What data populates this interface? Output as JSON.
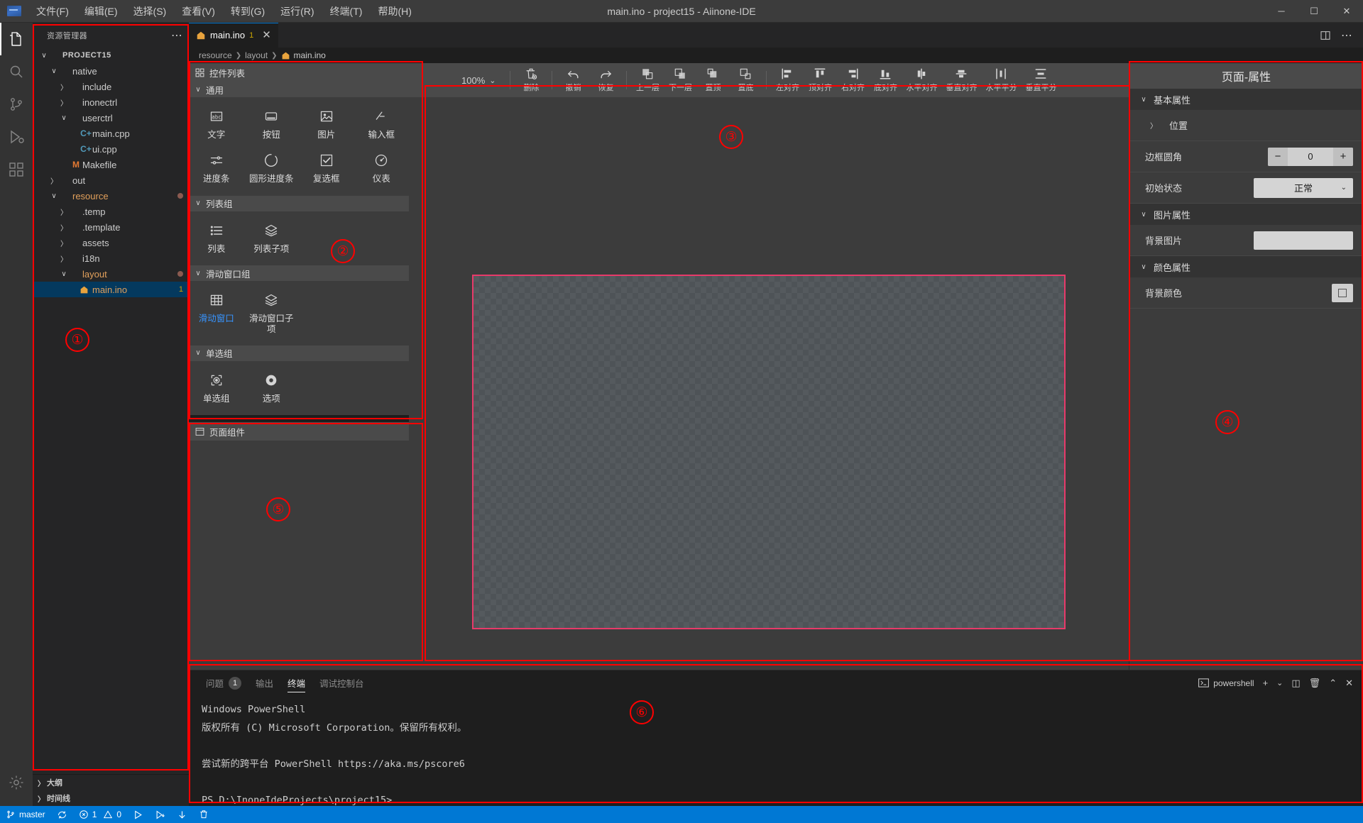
{
  "titlebar": {
    "title": "main.ino - project15 - Aiinone-IDE",
    "logo_icon": "app-logo-icon",
    "menus": [
      {
        "label": "文件(F)"
      },
      {
        "label": "编辑(E)"
      },
      {
        "label": "选择(S)"
      },
      {
        "label": "查看(V)"
      },
      {
        "label": "转到(G)"
      },
      {
        "label": "运行(R)"
      },
      {
        "label": "终端(T)"
      },
      {
        "label": "帮助(H)"
      }
    ],
    "window_controls": {
      "minimize": "─",
      "maximize": "☐",
      "close": "✕"
    }
  },
  "activitybar": {
    "items": [
      {
        "name": "explorer",
        "icon": "files-icon",
        "active": true
      },
      {
        "name": "search",
        "icon": "search-icon",
        "active": false
      },
      {
        "name": "source-control",
        "icon": "source-control-icon",
        "active": false
      },
      {
        "name": "run-debug",
        "icon": "run-debug-icon",
        "active": false
      },
      {
        "name": "extensions",
        "icon": "extensions-icon",
        "active": false
      }
    ],
    "bottom": [
      {
        "name": "settings",
        "icon": "gear-icon"
      }
    ]
  },
  "sidebar": {
    "header_title": "资源管理器",
    "more_actions": "⋯",
    "tree": [
      {
        "label": "PROJECT15",
        "depth": 0,
        "twisty": "open",
        "kind": "root"
      },
      {
        "label": "native",
        "depth": 1,
        "twisty": "open",
        "kind": "folder"
      },
      {
        "label": "include",
        "depth": 2,
        "twisty": "closed",
        "kind": "folder"
      },
      {
        "label": "inonectrl",
        "depth": 2,
        "twisty": "closed",
        "kind": "folder"
      },
      {
        "label": "userctrl",
        "depth": 2,
        "twisty": "open",
        "kind": "folder"
      },
      {
        "label": "main.cpp",
        "depth": 3,
        "twisty": "none",
        "kind": "cpp"
      },
      {
        "label": "ui.cpp",
        "depth": 3,
        "twisty": "none",
        "kind": "cpp"
      },
      {
        "label": "Makefile",
        "depth": 2,
        "twisty": "none",
        "kind": "make"
      },
      {
        "label": "out",
        "depth": 1,
        "twisty": "closed",
        "kind": "folder"
      },
      {
        "label": "resource",
        "depth": 1,
        "twisty": "open",
        "kind": "folder-mod",
        "badge_dot": true
      },
      {
        "label": ".temp",
        "depth": 2,
        "twisty": "closed",
        "kind": "folder"
      },
      {
        "label": ".template",
        "depth": 2,
        "twisty": "closed",
        "kind": "folder"
      },
      {
        "label": "assets",
        "depth": 2,
        "twisty": "closed",
        "kind": "folder"
      },
      {
        "label": "i18n",
        "depth": 2,
        "twisty": "closed",
        "kind": "folder"
      },
      {
        "label": "layout",
        "depth": 2,
        "twisty": "open",
        "kind": "folder-mod",
        "badge_dot": true
      },
      {
        "label": "main.ino",
        "depth": 3,
        "twisty": "none",
        "kind": "ino",
        "selected": true,
        "badge_num": "1"
      }
    ],
    "bottom_panels": [
      {
        "label": "大纲"
      },
      {
        "label": "时间线"
      }
    ]
  },
  "editor": {
    "tab": {
      "label": "main.ino",
      "badge": "1",
      "close": "✕",
      "icon": "ino-file-icon"
    },
    "tab_actions": [
      {
        "name": "split-editor-icon"
      },
      {
        "name": "more-actions-icon",
        "label": "⋯"
      }
    ],
    "breadcrumb": [
      "resource",
      "layout",
      "main.ino"
    ]
  },
  "palette": {
    "title": "控件列表",
    "title_icon": "widgets-icon",
    "groups": [
      {
        "name": "通用",
        "items": [
          {
            "label": "文字",
            "icon": "text-icon"
          },
          {
            "label": "按钮",
            "icon": "button-icon"
          },
          {
            "label": "图片",
            "icon": "image-icon"
          },
          {
            "label": "输入框",
            "icon": "input-icon"
          },
          {
            "label": "进度条",
            "icon": "slider-icon"
          },
          {
            "label": "圆形进度条",
            "icon": "circular-progress-icon"
          },
          {
            "label": "复选框",
            "icon": "checkbox-icon"
          },
          {
            "label": "仪表",
            "icon": "gauge-icon"
          }
        ]
      },
      {
        "name": "列表组",
        "items": [
          {
            "label": "列表",
            "icon": "list-icon"
          },
          {
            "label": "列表子项",
            "icon": "layers-icon"
          }
        ]
      },
      {
        "name": "滑动窗口组",
        "items": [
          {
            "label": "滑动窗口",
            "icon": "grid-icon",
            "accent": true
          },
          {
            "label": "滑动窗口子项",
            "icon": "layers-icon"
          }
        ]
      },
      {
        "name": "单选组",
        "items": [
          {
            "label": "单选组",
            "icon": "radio-group-icon"
          },
          {
            "label": "选项",
            "icon": "radio-icon"
          }
        ]
      }
    ],
    "page_components": {
      "title": "页面组件",
      "icon": "page-components-icon"
    }
  },
  "design_toolbar": {
    "zoom": "100%",
    "zoom_caret": "⌄",
    "buttons": [
      {
        "label": "删除",
        "icon": "delete-icon"
      },
      {
        "label": "撤销",
        "icon": "undo-icon"
      },
      {
        "label": "恢复",
        "icon": "redo-icon"
      },
      {
        "label": "上一层",
        "icon": "bring-forward-icon"
      },
      {
        "label": "下一层",
        "icon": "send-backward-icon"
      },
      {
        "label": "置顶",
        "icon": "bring-to-front-icon"
      },
      {
        "label": "置底",
        "icon": "send-to-back-icon"
      },
      {
        "label": "左对齐",
        "icon": "align-left-icon"
      },
      {
        "label": "顶对齐",
        "icon": "align-top-icon"
      },
      {
        "label": "右对齐",
        "icon": "align-right-icon"
      },
      {
        "label": "底对齐",
        "icon": "align-bottom-icon"
      },
      {
        "label": "水平对齐",
        "icon": "align-center-h-icon"
      },
      {
        "label": "垂直对齐",
        "icon": "align-center-v-icon"
      },
      {
        "label": "水平平分",
        "icon": "distribute-h-icon"
      },
      {
        "label": "垂直平分",
        "icon": "distribute-v-icon"
      }
    ]
  },
  "properties": {
    "title": "页面-属性",
    "sections": [
      {
        "name": "基本属性",
        "twisty": "open",
        "rows": [
          {
            "label": "位置",
            "type": "expander",
            "twisty": "closed"
          },
          {
            "label": "边框圆角",
            "type": "spinner",
            "value": "0",
            "minus": "−",
            "plus": "+"
          },
          {
            "label": "初始状态",
            "type": "select",
            "value": "正常",
            "caret": "⌄"
          }
        ]
      },
      {
        "name": "图片属性",
        "twisty": "open",
        "rows": [
          {
            "label": "背景图片",
            "type": "text",
            "value": ""
          }
        ]
      },
      {
        "name": "颜色属性",
        "twisty": "open",
        "rows": [
          {
            "label": "背景颜色",
            "type": "color",
            "value": ""
          }
        ]
      }
    ]
  },
  "panel": {
    "tabs": [
      {
        "label": "问题",
        "count": "1",
        "active": false
      },
      {
        "label": "输出",
        "active": false
      },
      {
        "label": "终端",
        "active": true
      },
      {
        "label": "调试控制台",
        "active": false
      }
    ],
    "shell_name": "powershell",
    "shell_icon": "powershell-icon",
    "actions": [
      {
        "name": "new-terminal-icon",
        "glyph": "+"
      },
      {
        "name": "terminal-dropdown-icon",
        "glyph": "⌄"
      },
      {
        "name": "split-terminal-icon",
        "glyph": "◫"
      },
      {
        "name": "kill-terminal-icon",
        "glyph": "🗑"
      },
      {
        "name": "maximize-panel-icon",
        "glyph": "⌃"
      },
      {
        "name": "close-panel-icon",
        "glyph": "✕"
      }
    ],
    "terminal_lines": [
      "Windows PowerShell",
      "版权所有 (C) Microsoft Corporation。保留所有权利。",
      "",
      "尝试新的跨平台 PowerShell https://aka.ms/pscore6",
      "",
      "PS D:\\InoneIdeProjects\\project15>"
    ]
  },
  "statusbar": {
    "branch": "master",
    "branch_icon": "source-control-icon",
    "sync_icon": "sync-icon",
    "error_icon": "error-icon",
    "errors": "1",
    "warning_icon": "warning-icon",
    "warnings": "0",
    "items": [
      {
        "name": "run-icon",
        "glyph": "▷"
      },
      {
        "name": "run-step-icon",
        "glyph": "▷"
      },
      {
        "name": "download-icon",
        "glyph": "↓"
      },
      {
        "name": "trash-icon",
        "glyph": "🗑"
      }
    ]
  },
  "annotations": [
    {
      "num": "①",
      "label": "explorer-region"
    },
    {
      "num": "②",
      "label": "widget-palette-region"
    },
    {
      "num": "③",
      "label": "canvas-region"
    },
    {
      "num": "④",
      "label": "properties-region"
    },
    {
      "num": "⑤",
      "label": "page-components-region"
    },
    {
      "num": "⑥",
      "label": "terminal-region"
    }
  ]
}
